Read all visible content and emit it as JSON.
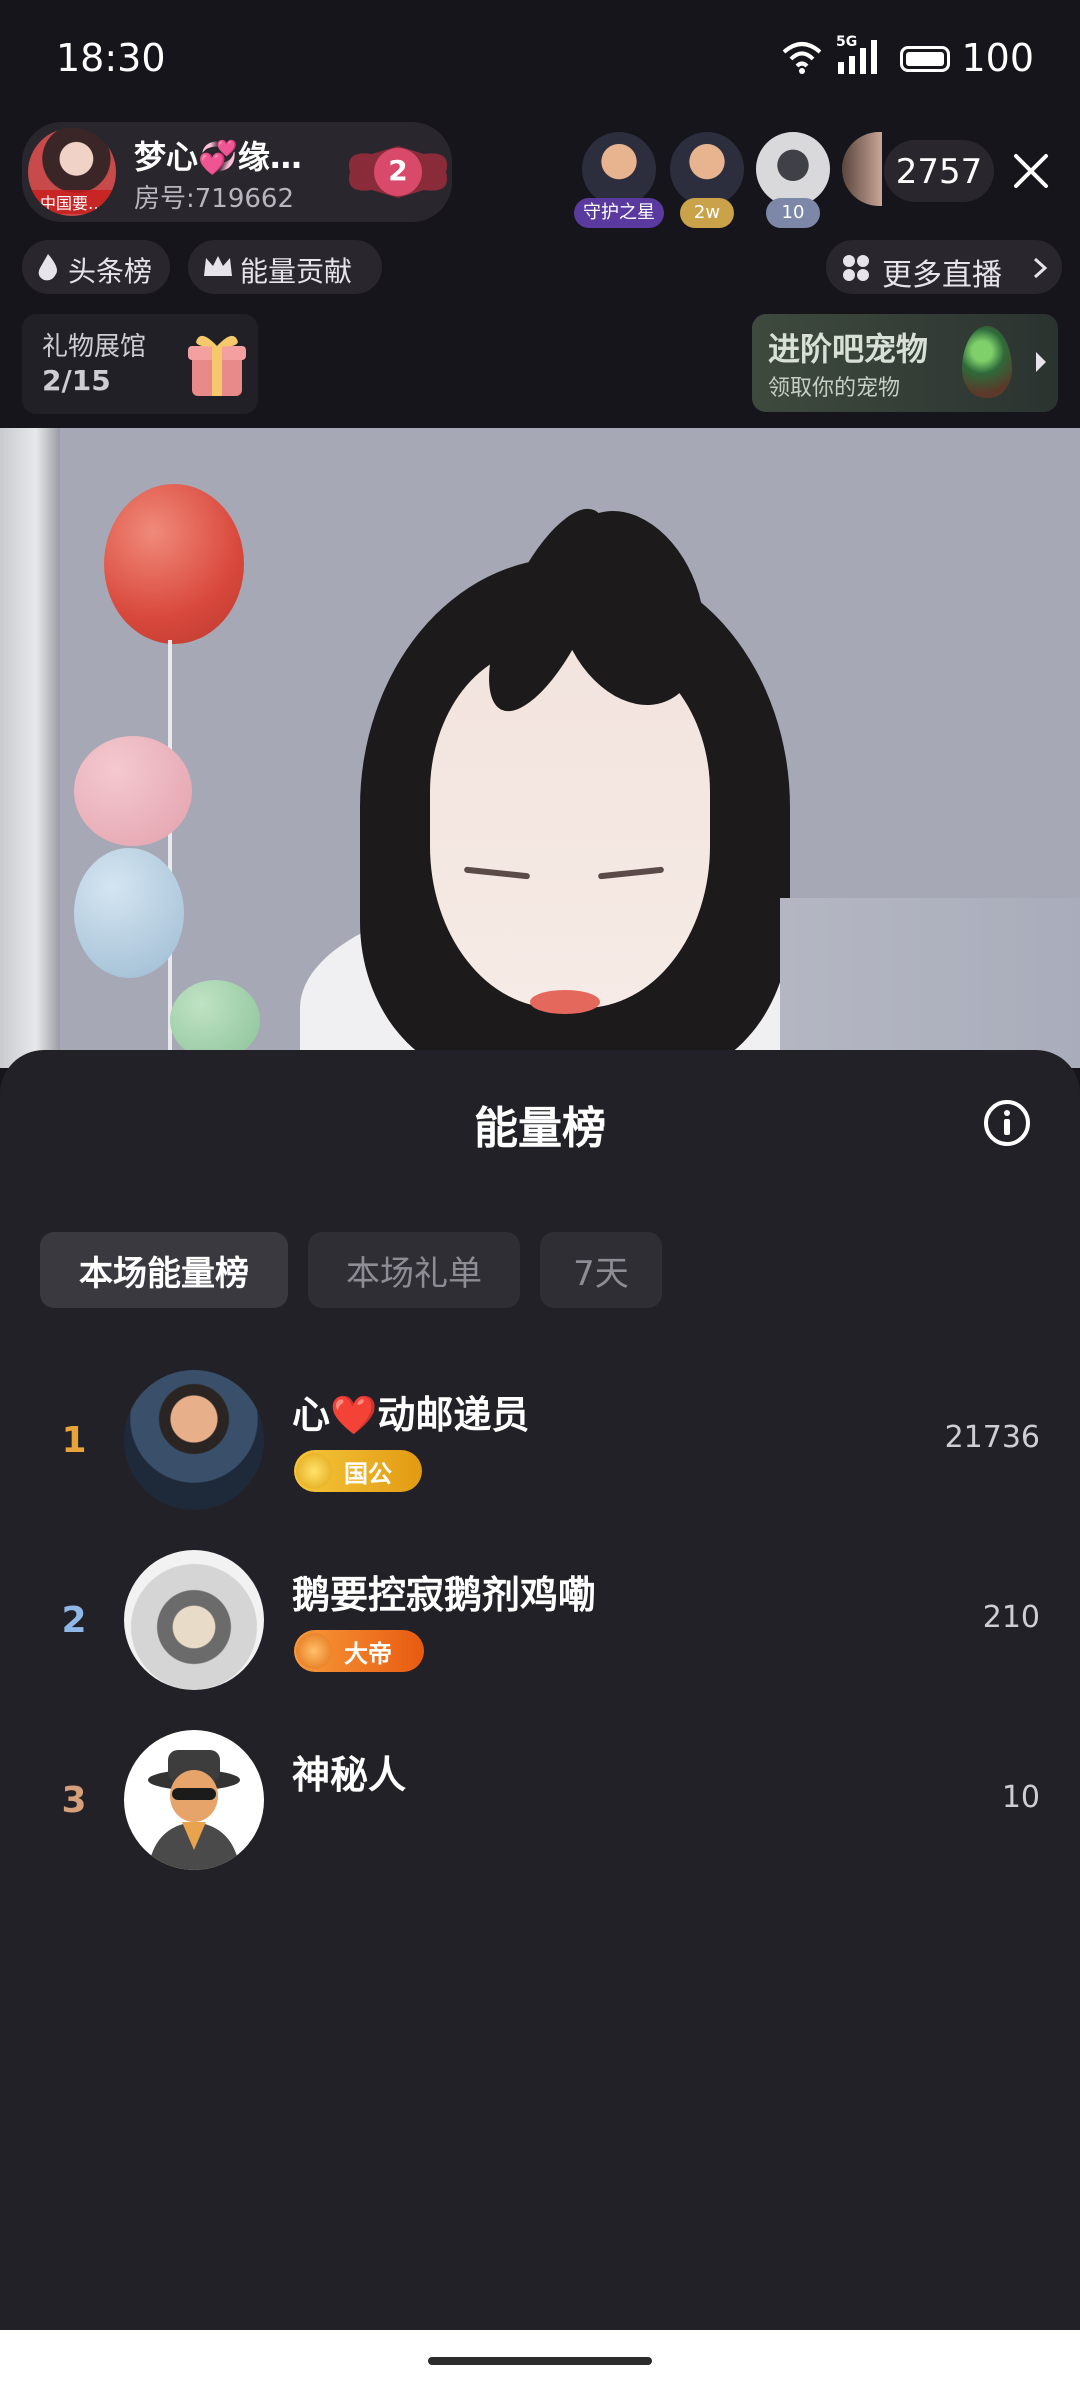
{
  "status_bar": {
    "time": "18:30",
    "battery": "100",
    "network": "5G"
  },
  "header": {
    "streamer_name": "梦心💞缘…",
    "room_id": "房号:719662",
    "streamer_avatar_tag": "中国要…",
    "fan_level": "2",
    "top_viewers": [
      {
        "badge": "守护之星"
      },
      {
        "badge": "2w"
      },
      {
        "badge": "10"
      }
    ],
    "viewer_count": "2757",
    "links": {
      "headline": "头条榜",
      "energy_contrib": "能量贡献",
      "more_live": "更多直播"
    },
    "gift_hall": {
      "label": "礼物展馆",
      "progress": "2/15"
    },
    "pet_promo": {
      "title": "进阶吧宠物",
      "subtitle": "领取你的宠物"
    }
  },
  "sheet": {
    "title": "能量榜",
    "tabs": [
      {
        "label": "本场能量榜",
        "active": true
      },
      {
        "label": "本场礼单",
        "active": false
      },
      {
        "label": "7天",
        "active": false
      }
    ],
    "rows": [
      {
        "rank": "1",
        "rank_color": "#e8a33a",
        "name": "心❤️动邮递员",
        "badge": "国公",
        "badge_color": "#f0b619",
        "score": "21736"
      },
      {
        "rank": "2",
        "rank_color": "#8fb8e6",
        "name": "鹅要控寂鹅剂鸡嘞",
        "badge": "大帝",
        "badge_color": "#f27a1a",
        "score": "210"
      },
      {
        "rank": "3",
        "rank_color": "#d6a07a",
        "name": "神秘人",
        "badge": "",
        "badge_color": "",
        "score": "10"
      }
    ]
  }
}
